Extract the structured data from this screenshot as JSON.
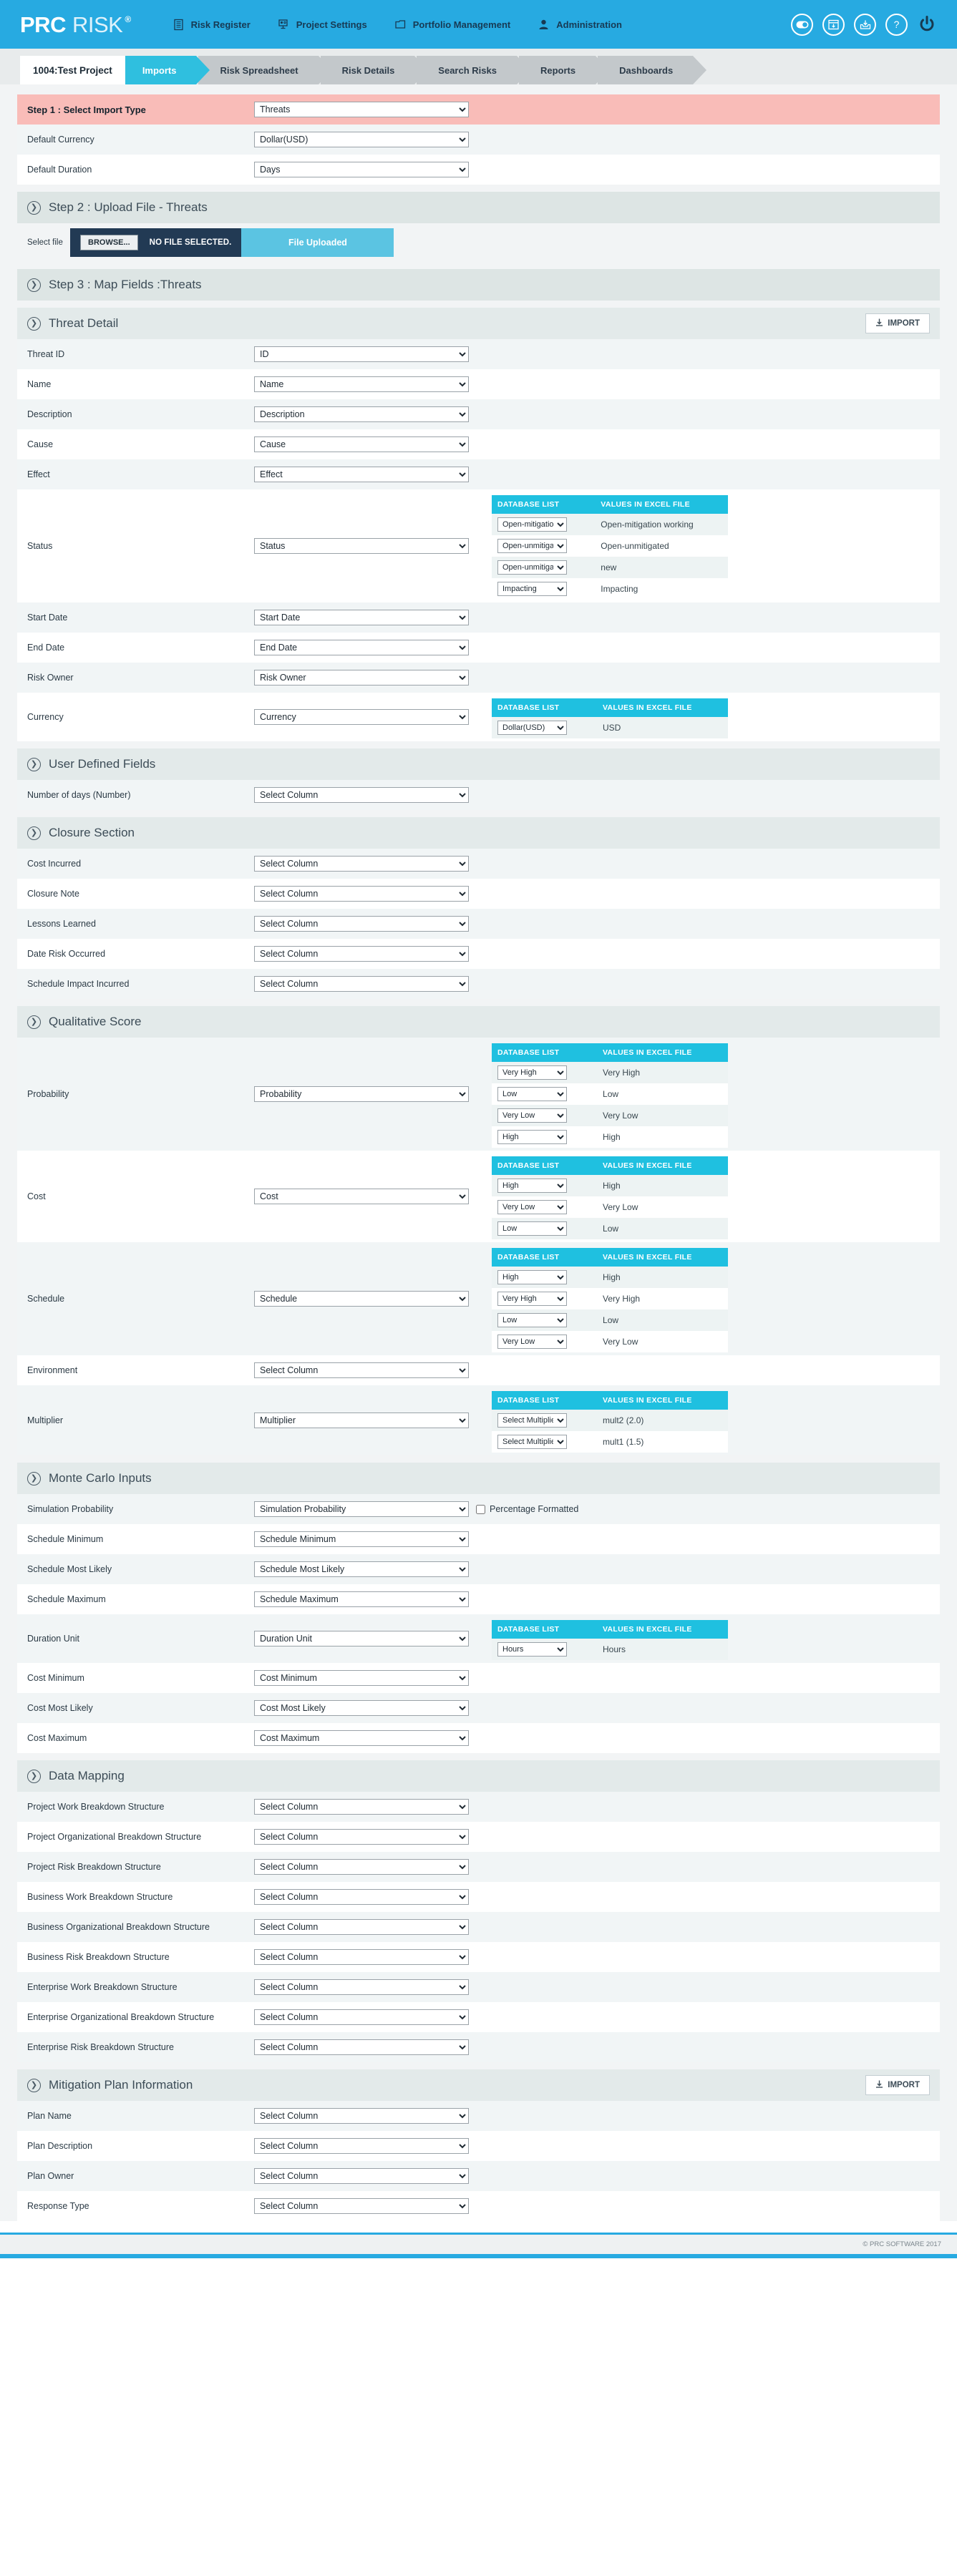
{
  "header": {
    "logo": {
      "prc": "PRC",
      "risk": "RISK",
      "registered": "®"
    },
    "nav": [
      {
        "label": "Risk Register",
        "icon": "document-icon"
      },
      {
        "label": "Project Settings",
        "icon": "settings-screen-icon"
      },
      {
        "label": "Portfolio Management",
        "icon": "folder-icon"
      },
      {
        "label": "Administration",
        "icon": "user-icon"
      }
    ],
    "right_icons": [
      {
        "name": "toggle-icon"
      },
      {
        "name": "calendar-download-icon"
      },
      {
        "name": "inbox-download-icon"
      },
      {
        "name": "help-icon"
      },
      {
        "name": "power-icon"
      }
    ]
  },
  "tabs": {
    "project": "1004:Test Project",
    "items": [
      {
        "label": "Imports",
        "active": true
      },
      {
        "label": "Risk Spreadsheet",
        "active": false
      },
      {
        "label": "Risk Details",
        "active": false
      },
      {
        "label": "Search Risks",
        "active": false
      },
      {
        "label": "Reports",
        "active": false
      },
      {
        "label": "Dashboards",
        "active": false
      }
    ]
  },
  "step1": {
    "title": "Step 1 : Select Import Type",
    "import_type": "Threats",
    "rows": [
      {
        "label": "Default Currency",
        "value": "Dollar(USD)"
      },
      {
        "label": "Default Duration",
        "value": "Days"
      }
    ]
  },
  "step2": {
    "title": "Step 2 : Upload File - Threats",
    "select_file_label": "Select file",
    "browse_label": "BROWSE...",
    "no_file_label": "NO FILE SELECTED.",
    "uploaded_label": "File Uploaded"
  },
  "step3": {
    "title": "Step 3 : Map Fields :Threats"
  },
  "maptable_headers": {
    "db": "DATABASE LIST",
    "excel": "VALUES IN EXCEL FILE"
  },
  "threat_detail": {
    "title": "Threat Detail",
    "import_label": "IMPORT",
    "rows": [
      {
        "label": "Threat ID",
        "value": "ID"
      },
      {
        "label": "Name",
        "value": "Name"
      },
      {
        "label": "Description",
        "value": "Description"
      },
      {
        "label": "Cause",
        "value": "Cause"
      },
      {
        "label": "Effect",
        "value": "Effect"
      }
    ],
    "status": {
      "label": "Status",
      "value": "Status",
      "mappings": [
        {
          "db": "Open-mitigation working",
          "excel": "Open-mitigation working"
        },
        {
          "db": "Open-unmitigated",
          "excel": "Open-unmitigated"
        },
        {
          "db": "Open-unmitigated",
          "excel": "new"
        },
        {
          "db": "Impacting",
          "excel": "Impacting"
        }
      ]
    },
    "rows2": [
      {
        "label": "Start Date",
        "value": "Start Date"
      },
      {
        "label": "End Date",
        "value": "End Date"
      },
      {
        "label": "Risk Owner",
        "value": "Risk Owner"
      }
    ],
    "currency": {
      "label": "Currency",
      "value": "Currency",
      "mappings": [
        {
          "db": "Dollar(USD)",
          "excel": "USD"
        }
      ]
    }
  },
  "user_defined": {
    "title": "User Defined Fields",
    "rows": [
      {
        "label": "Number of days (Number)",
        "value": "Select Column"
      }
    ]
  },
  "closure": {
    "title": "Closure Section",
    "rows": [
      {
        "label": "Cost Incurred",
        "value": "Select Column"
      },
      {
        "label": "Closure Note",
        "value": "Select Column"
      },
      {
        "label": "Lessons Learned",
        "value": "Select Column"
      },
      {
        "label": "Date Risk Occurred",
        "value": "Select Column"
      },
      {
        "label": "Schedule Impact Incurred",
        "value": "Select Column"
      }
    ]
  },
  "qualitative": {
    "title": "Qualitative Score",
    "probability": {
      "label": "Probability",
      "value": "Probability",
      "mappings": [
        {
          "db": "Very High",
          "excel": "Very High"
        },
        {
          "db": "Low",
          "excel": "Low"
        },
        {
          "db": "Very Low",
          "excel": "Very Low"
        },
        {
          "db": "High",
          "excel": "High"
        }
      ]
    },
    "cost": {
      "label": "Cost",
      "value": "Cost",
      "mappings": [
        {
          "db": "High",
          "excel": "High"
        },
        {
          "db": "Very Low",
          "excel": "Very Low"
        },
        {
          "db": "Low",
          "excel": "Low"
        }
      ]
    },
    "schedule": {
      "label": "Schedule",
      "value": "Schedule",
      "mappings": [
        {
          "db": "High",
          "excel": "High"
        },
        {
          "db": "Very High",
          "excel": "Very High"
        },
        {
          "db": "Low",
          "excel": "Low"
        },
        {
          "db": "Very Low",
          "excel": "Very Low"
        }
      ]
    },
    "environment": {
      "label": "Environment",
      "value": "Select Column"
    },
    "multiplier": {
      "label": "Multiplier",
      "value": "Multiplier",
      "mappings": [
        {
          "db": "Select Multiplier",
          "excel": "mult2 (2.0)"
        },
        {
          "db": "Select Multiplier",
          "excel": "mult1 (1.5)"
        }
      ]
    }
  },
  "monte_carlo": {
    "title": "Monte Carlo Inputs",
    "simulation_probability": {
      "label": "Simulation Probability",
      "value": "Simulation Probability"
    },
    "percentage_formatted": "Percentage Formatted",
    "rows": [
      {
        "label": "Schedule Minimum",
        "value": "Schedule Minimum"
      },
      {
        "label": "Schedule Most Likely",
        "value": "Schedule Most Likely"
      },
      {
        "label": "Schedule Maximum",
        "value": "Schedule Maximum"
      }
    ],
    "duration_unit": {
      "label": "Duration Unit",
      "value": "Duration Unit",
      "mappings": [
        {
          "db": "Hours",
          "excel": "Hours"
        }
      ]
    },
    "rows2": [
      {
        "label": "Cost Minimum",
        "value": "Cost Minimum"
      },
      {
        "label": "Cost Most Likely",
        "value": "Cost Most Likely"
      },
      {
        "label": "Cost Maximum",
        "value": "Cost Maximum"
      }
    ]
  },
  "data_mapping": {
    "title": "Data Mapping",
    "rows": [
      {
        "label": "Project Work Breakdown Structure",
        "value": "Select Column"
      },
      {
        "label": "Project Organizational Breakdown Structure",
        "value": "Select Column"
      },
      {
        "label": "Project Risk Breakdown Structure",
        "value": "Select Column"
      },
      {
        "label": "Business Work Breakdown Structure",
        "value": "Select Column"
      },
      {
        "label": "Business Organizational Breakdown Structure",
        "value": "Select Column"
      },
      {
        "label": "Business Risk Breakdown Structure",
        "value": "Select Column"
      },
      {
        "label": "Enterprise Work Breakdown Structure",
        "value": "Select Column"
      },
      {
        "label": "Enterprise Organizational Breakdown Structure",
        "value": "Select Column"
      },
      {
        "label": "Enterprise Risk Breakdown Structure",
        "value": "Select Column"
      }
    ]
  },
  "mitigation": {
    "title": "Mitigation Plan Information",
    "import_label": "IMPORT",
    "rows": [
      {
        "label": "Plan Name",
        "value": "Select Column"
      },
      {
        "label": "Plan Description",
        "value": "Select Column"
      },
      {
        "label": "Plan Owner",
        "value": "Select Column"
      },
      {
        "label": "Response Type",
        "value": "Select Column"
      }
    ]
  },
  "footer": {
    "copyright": "© PRC SOFTWARE 2017"
  },
  "colors": {
    "brand": "#27aae1",
    "accent": "#1fc0e0",
    "pink": "#f9bcb8",
    "dark": "#223a54"
  }
}
